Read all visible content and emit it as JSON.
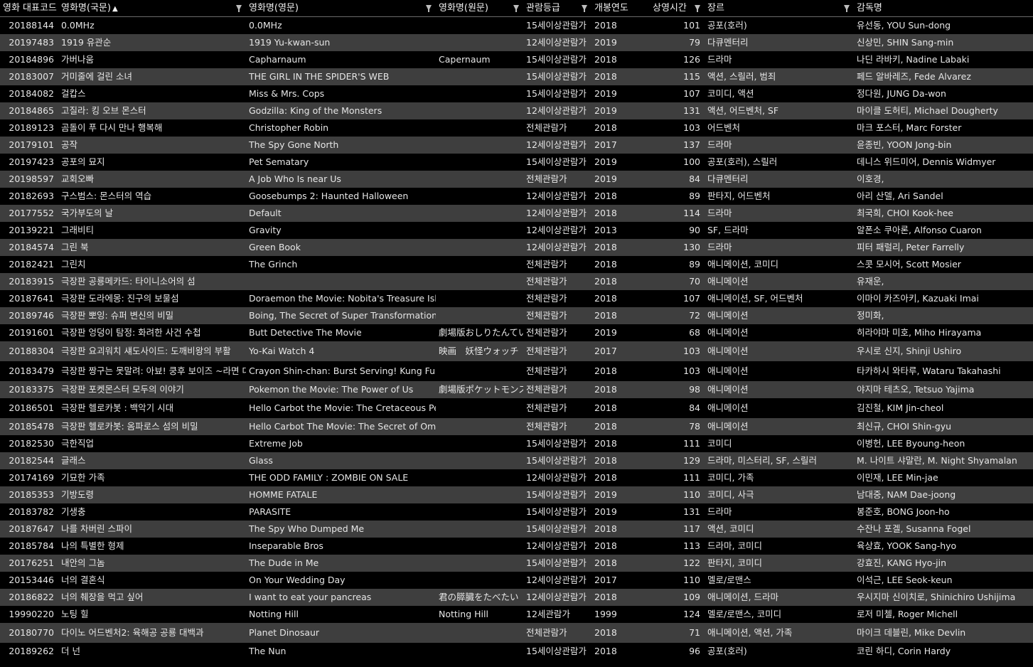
{
  "columns": [
    {
      "label": "영화 대표코드",
      "sort": "",
      "filter": false
    },
    {
      "label": "영화명(국문)",
      "sort": "▲",
      "filter": true
    },
    {
      "label": "영화명(영문)",
      "sort": "",
      "filter": true
    },
    {
      "label": "영화명(원문)",
      "sort": "",
      "filter": true
    },
    {
      "label": "관람등급",
      "sort": "",
      "filter": true
    },
    {
      "label": "개봉연도",
      "sort": "",
      "filter": false
    },
    {
      "label": "상영시간",
      "sort": "",
      "filter": true
    },
    {
      "label": "장르",
      "sort": "",
      "filter": true
    },
    {
      "label": "감독명",
      "sort": "",
      "filter": false
    }
  ],
  "rows": [
    [
      "20188144",
      "0.0MHz",
      "0.0MHz",
      "",
      "15세이상관람가",
      "2018",
      "101",
      "공포(호러)",
      "유선동, YOU Sun-dong"
    ],
    [
      "20197483",
      "1919 유관순",
      "1919 Yu-kwan-sun",
      "",
      "12세이상관람가",
      "2019",
      "79",
      "다큐멘터리",
      "신상민, SHIN Sang-min"
    ],
    [
      "20184896",
      "가버나움",
      "Capharnaum",
      "Capernaum",
      "15세이상관람가",
      "2018",
      "126",
      "드라마",
      "나딘 라바키, Nadine Labaki"
    ],
    [
      "20183007",
      "거미줄에 걸린 소녀",
      "THE GIRL IN THE SPIDER'S WEB",
      "",
      "15세이상관람가",
      "2018",
      "115",
      "액션, 스릴러, 범죄",
      "페드 알바레즈, Fede Alvarez"
    ],
    [
      "20184082",
      "걸캅스",
      "Miss & Mrs. Cops",
      "",
      "15세이상관람가",
      "2019",
      "107",
      "코미디, 액션",
      "정다원, JUNG Da-won"
    ],
    [
      "20184865",
      "고질라: 킹 오브 몬스터",
      "Godzilla: King of the Monsters",
      "",
      "12세이상관람가",
      "2019",
      "131",
      "액션, 어드벤처, SF",
      "마이클 도허티, Michael Dougherty"
    ],
    [
      "20189123",
      "곰돌이 푸 다시 만나 행복해",
      "Christopher Robin",
      "",
      "전체관람가",
      "2018",
      "103",
      "어드벤처",
      "마크 포스터, Marc Forster"
    ],
    [
      "20179101",
      "공작",
      "The Spy Gone North",
      "",
      "12세이상관람가",
      "2017",
      "137",
      "드라마",
      "윤종빈, YOON Jong-bin"
    ],
    [
      "20197423",
      "공포의 묘지",
      "Pet Sematary",
      "",
      "15세이상관람가",
      "2019",
      "100",
      "공포(호러), 스릴러",
      "데니스 위드미어, Dennis Widmyer"
    ],
    [
      "20198597",
      "교회오빠",
      "A Job Who Is near Us",
      "",
      "전체관람가",
      "2019",
      "84",
      "다큐멘터리",
      "이호경,"
    ],
    [
      "20182693",
      "구스범스: 몬스터의 역습",
      "Goosebumps 2: Haunted Halloween",
      "",
      "12세이상관람가",
      "2018",
      "89",
      "판타지, 어드벤처",
      "아리 산델, Ari Sandel"
    ],
    [
      "20177552",
      "국가부도의 날",
      "Default",
      "",
      "12세이상관람가",
      "2018",
      "114",
      "드라마",
      "최국희, CHOI Kook-hee"
    ],
    [
      "20139221",
      "그래비티",
      "Gravity",
      "",
      "12세이상관람가",
      "2013",
      "90",
      "SF, 드라마",
      "알폰소 쿠아론, Alfonso Cuaron"
    ],
    [
      "20184574",
      "그린 북",
      "Green Book",
      "",
      "12세이상관람가",
      "2018",
      "130",
      "드라마",
      "피터 패럴리, Peter Farrelly"
    ],
    [
      "20182421",
      "그린치",
      "The Grinch",
      "",
      "전체관람가",
      "2018",
      "89",
      "애니메이션, 코미디",
      "스콧 모시어, Scott Mosier"
    ],
    [
      "20183915",
      "극장판 공룡메카드: 타이니소어의 섬",
      "",
      "",
      "전체관람가",
      "2018",
      "70",
      "애니메이션",
      "유재운,"
    ],
    [
      "20187641",
      "극장판 도라에몽: 진구의 보물섬",
      "Doraemon the Movie: Nobita's Treasure Island",
      "",
      "전체관람가",
      "2018",
      "107",
      "애니메이션, SF, 어드벤처",
      "이마이 카즈아키, Kazuaki Imai"
    ],
    [
      "20189746",
      "극장판 뽀잉: 슈퍼 변신의 비밀",
      "Boing, The Secret of Super Transformation",
      "",
      "전체관람가",
      "2018",
      "72",
      "애니메이션",
      "정미화,"
    ],
    [
      "20191601",
      "극장판 엉덩이 탐정: 화려한 사건 수첩",
      "Butt Detective The Movie",
      "劇場版おしりたんてい",
      "전체관람가",
      "2019",
      "68",
      "애니메이션",
      "히라야마 미호, Miho Hirayama"
    ],
    [
      "20188304",
      "극장판 요괴워치 섀도사이드: 도깨비왕의 부활",
      "Yo-Kai Watch 4",
      "映画　妖怪ウォッチ",
      "전체관람가",
      "2017",
      "103",
      "애니메이션",
      "우시로 신지, Shinji Ushiro"
    ],
    [
      "20183479",
      "극장판 짱구는 못말려: 아뵤! 쿵후 보이즈 ~라면 대란~",
      "Crayon Shin-chan: Burst Serving! Kung Fu Boys",
      "",
      "전체관람가",
      "2018",
      "103",
      "애니메이션",
      "타카하시 와타루, Wataru Takahashi"
    ],
    [
      "20183375",
      "극장판 포켓몬스터 모두의 이야기",
      "Pokemon the Movie: The Power of Us",
      "劇場版ポケットモンスター",
      "전체관람가",
      "2018",
      "98",
      "애니메이션",
      "야지마 테츠오, Tetsuo Yajima"
    ],
    [
      "20186501",
      "극장판 헬로카봇 : 백악기 시대",
      "Hello Carbot the Movie: The Cretaceous Period",
      "",
      "전체관람가",
      "2018",
      "84",
      "애니메이션",
      "김진철, KIM Jin-cheol"
    ],
    [
      "20185478",
      "극장판 헬로카봇: 옴파로스 섬의 비밀",
      "Hello Carbot The Movie: The Secret of Omphalos",
      "",
      "전체관람가",
      "2018",
      "78",
      "애니메이션",
      "최신규, CHOI Shin-gyu"
    ],
    [
      "20182530",
      "극한직업",
      "Extreme Job",
      "",
      "15세이상관람가",
      "2018",
      "111",
      "코미디",
      "이병헌, LEE Byoung-heon"
    ],
    [
      "20182544",
      "글래스",
      "Glass",
      "",
      "15세이상관람가",
      "2018",
      "129",
      "드라마, 미스터리, SF, 스릴러",
      "M. 나이트 샤말란, M. Night Shyamalan"
    ],
    [
      "20174169",
      "기묘한 가족",
      "THE ODD FAMILY : ZOMBIE ON SALE",
      "",
      "12세이상관람가",
      "2018",
      "111",
      "코미디, 가족",
      "이민재, LEE Min-jae"
    ],
    [
      "20185353",
      "기방도령",
      "HOMME FATALE",
      "",
      "15세이상관람가",
      "2019",
      "110",
      "코미디, 사극",
      "남대중, NAM Dae-joong"
    ],
    [
      "20183782",
      "기생충",
      "PARASITE",
      "",
      "15세이상관람가",
      "2019",
      "131",
      "드라마",
      "봉준호, BONG Joon-ho"
    ],
    [
      "20187647",
      "나를 차버린 스파이",
      "The Spy Who Dumped Me",
      "",
      "15세이상관람가",
      "2018",
      "117",
      "액션, 코미디",
      "수잔나 포겔, Susanna Fogel"
    ],
    [
      "20185784",
      "나의 특별한 형제",
      "Inseparable Bros",
      "",
      "12세이상관람가",
      "2018",
      "113",
      "드라마, 코미디",
      "육상효, YOOK Sang-hyo"
    ],
    [
      "20176251",
      "내안의 그놈",
      "The Dude in Me",
      "",
      "15세이상관람가",
      "2018",
      "122",
      "판타지, 코미디",
      "강효진, KANG Hyo-jin"
    ],
    [
      "20153446",
      "너의 결혼식",
      "On Your Wedding Day",
      "",
      "12세이상관람가",
      "2017",
      "110",
      "멜로/로맨스",
      "이석근, LEE Seok-keun"
    ],
    [
      "20186822",
      "너의 췌장을 먹고 싶어",
      "I want to eat your pancreas",
      "君の膵臓をたべたい",
      "12세이상관람가",
      "2018",
      "109",
      "애니메이션, 드라마",
      "우시지마 신이치로, Shinichiro Ushijima"
    ],
    [
      "19990220",
      "노팅 힐",
      "Notting Hill",
      "Notting Hill",
      "12세관람가",
      "1999",
      "124",
      "멜로/로맨스, 코미디",
      "로저 미첼, Roger Michell"
    ],
    [
      "20180770",
      "다이노 어드벤처2: 육해공 공룡 대백과",
      "Planet Dinosaur",
      "",
      "전체관람가",
      "2018",
      "71",
      "애니메이션, 액션, 가족",
      "마이크 데블린, Mike Devlin"
    ],
    [
      "20189262",
      "더 넌",
      "The Nun",
      "",
      "15세이상관람가",
      "2018",
      "96",
      "공포(호러)",
      "코린 하디, Corin Hardy"
    ]
  ]
}
